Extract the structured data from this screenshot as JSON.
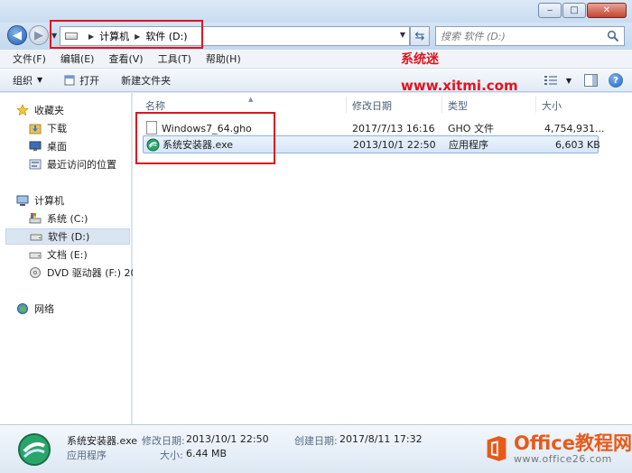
{
  "window": {
    "minimize": "‒",
    "maximize": "□",
    "close": "✕"
  },
  "address": {
    "crumbs": [
      "计算机",
      "软件 (D:)"
    ]
  },
  "search": {
    "placeholder": "搜索 软件 (D:)"
  },
  "menu": [
    "文件(F)",
    "编辑(E)",
    "查看(V)",
    "工具(T)",
    "帮助(H)"
  ],
  "toolbar": {
    "organize": "组织",
    "open": "打开",
    "new_folder": "新建文件夹"
  },
  "watermark": {
    "site_name": "系统迷",
    "site_url": "www.xitmi.com"
  },
  "nav": {
    "favorites": "收藏夹",
    "favorites_items": [
      "下载",
      "桌面",
      "最近访问的位置"
    ],
    "computer": "计算机",
    "drives": [
      "系统 (C:)",
      "软件 (D:)",
      "文档 (E:)",
      "DVD 驱动器 (F:) 20"
    ],
    "network": "网络"
  },
  "columns": {
    "name": "名称",
    "date": "修改日期",
    "type": "类型",
    "size": "大小"
  },
  "files": [
    {
      "name": "Windows7_64.gho",
      "date": "2017/7/13 16:16",
      "type": "GHO 文件",
      "size": "4,754,931...",
      "icon": "gho-file-icon",
      "selected": false
    },
    {
      "name": "系统安装器.exe",
      "date": "2013/10/1 22:50",
      "type": "应用程序",
      "size": "6,603 KB",
      "icon": "exe-app-icon",
      "selected": true
    }
  ],
  "details": {
    "name": "系统安装器.exe",
    "kind": "应用程序",
    "modified_label": "修改日期:",
    "modified_value": "2013/10/1 22:50",
    "size_label": "大小:",
    "size_value": "6.44 MB",
    "created_label": "创建日期:",
    "created_value": "2017/8/11 17:32"
  },
  "office_logo": {
    "big": "Office教程网",
    "small": "www.office26.com"
  },
  "colors": {
    "highlight": "#e0141e",
    "selection": "#d6e6f8",
    "chrome": "#c9dcf0",
    "office": "#e85a1a"
  }
}
